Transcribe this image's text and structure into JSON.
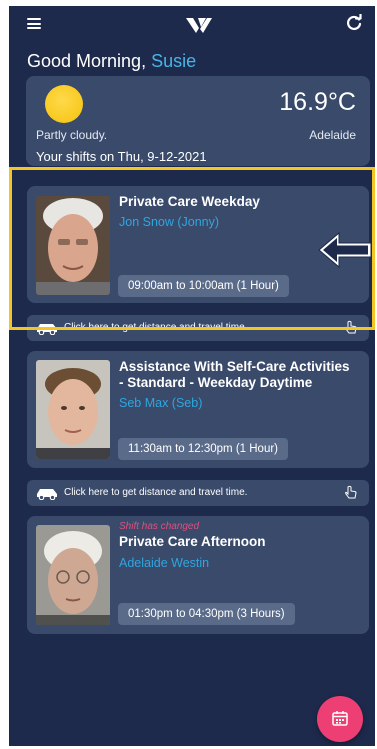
{
  "header": {
    "menu_icon": "hamburger-menu-icon",
    "logo_icon": "app-logo-icon",
    "refresh_icon": "refresh-icon"
  },
  "greeting": {
    "text": "Good Morning,",
    "name": "Susie"
  },
  "weather": {
    "temperature": "16.9°C",
    "condition": "Partly cloudy.",
    "location": "Adelaide",
    "shifts_label": "Your shifts on Thu, 9-12-2021",
    "icon": "sun-icon"
  },
  "shifts": [
    {
      "title": "Private Care Weekday",
      "client": "Jon Snow (Jonny)",
      "time": "09:00am to 10:00am (1 Hour)",
      "notice": ""
    },
    {
      "title_line1": "Assistance With Self-Care Activities",
      "title_line2": "- Standard - Weekday Daytime",
      "client": "Seb Max (Seb)",
      "time": "11:30am to 12:30pm (1 Hour)",
      "notice": ""
    },
    {
      "title": "Private Care Afternoon",
      "client": "Adelaide Westin",
      "time": "01:30pm to 04:30pm (3 Hours)",
      "notice": "Shift has changed"
    }
  ],
  "travel": {
    "label": "Click here to get distance and travel time."
  },
  "fab": {
    "icon": "calendar-icon"
  },
  "colors": {
    "background": "#1e2a4c",
    "card": "#3a4a6b",
    "accent": "#2ea6df",
    "highlight": "#f2c624",
    "fab": "#ee3f74",
    "notice": "#e04f7e"
  }
}
